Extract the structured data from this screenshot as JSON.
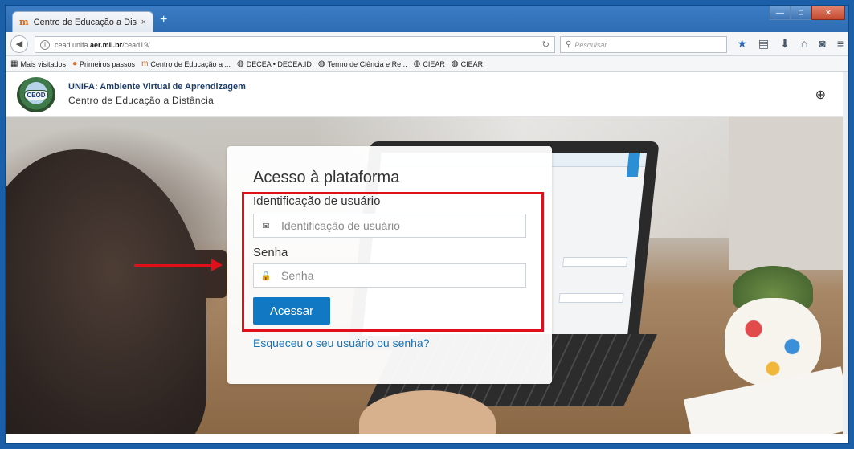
{
  "browser": {
    "tab_title": "Centro de Educação a Dist...",
    "tab_close": "×",
    "new_tab": "+",
    "url_prefix": "cead.unifa.",
    "url_domain": "aer.mil.br",
    "url_path": "/cead19/",
    "search_placeholder": "Pesquisar",
    "bookmarks": [
      {
        "label": "Mais visitados",
        "icon": "folder-icon"
      },
      {
        "label": "Primeiros passos",
        "icon": "firefox-icon"
      },
      {
        "label": "Centro de Educação a ...",
        "icon": "moodle-icon"
      },
      {
        "label": "DECEA • DECEA.ID",
        "icon": "globe-icon"
      },
      {
        "label": "Termo de Ciência e Re...",
        "icon": "globe-icon"
      },
      {
        "label": "CIEAR",
        "icon": "globe-icon"
      },
      {
        "label": "CIEAR",
        "icon": "globe-icon"
      }
    ]
  },
  "site": {
    "logo_text": "CEOD",
    "title": "UNIFA: Ambiente Virtual de Aprendizagem",
    "subtitle": "Centro de Educação a Distância"
  },
  "login": {
    "title": "Acesso à plataforma",
    "username_label": "Identificação de usuário",
    "username_placeholder": "Identificação de usuário",
    "password_label": "Senha",
    "password_placeholder": "Senha",
    "submit_label": "Acessar",
    "forgot_link": "Esqueceu o seu usuário ou senha?"
  },
  "colors": {
    "accent": "#1178c3",
    "link": "#1a73b8",
    "annotation": "#e0101a"
  }
}
